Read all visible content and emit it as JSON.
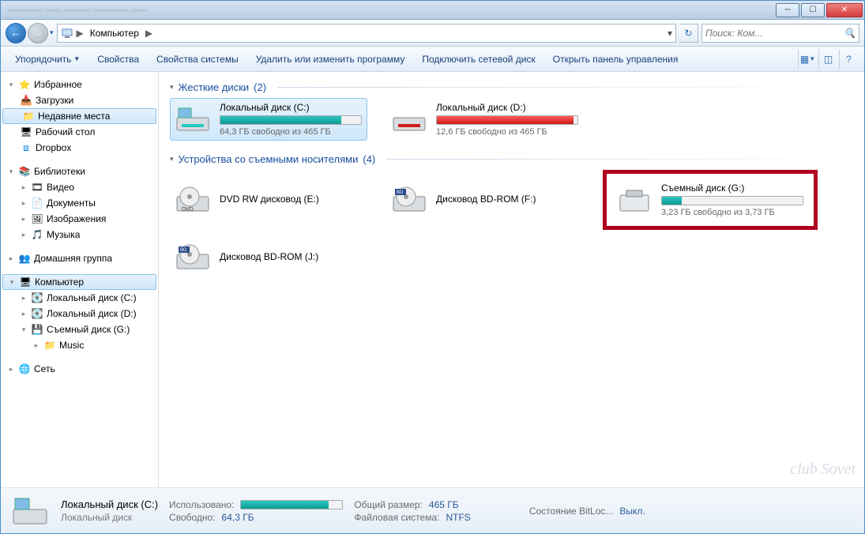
{
  "titlebar": {
    "blurred_text": "———— —— ——— ———— ——"
  },
  "address": {
    "location": "Компьютер",
    "chevron": "▶",
    "dropdown": "▾"
  },
  "search": {
    "placeholder": "Поиск: Ком..."
  },
  "toolbar": {
    "organize": "Упорядочить",
    "properties": "Свойства",
    "sysprops": "Свойства системы",
    "uninstall": "Удалить или изменить программу",
    "mapdrive": "Подключить сетевой диск",
    "controlpanel": "Открыть панель управления"
  },
  "sidebar": {
    "favorites": "Избранное",
    "downloads": "Загрузки",
    "recent": "Недавние места",
    "desktop": "Рабочий стол",
    "dropbox": "Dropbox",
    "libraries": "Библиотеки",
    "video": "Видео",
    "documents": "Документы",
    "pictures": "Изображения",
    "music": "Музыка",
    "homegroup": "Домашняя группа",
    "computer": "Компьютер",
    "localC": "Локальный диск (C:)",
    "localD": "Локальный диск (D:)",
    "removableG": "Съемный диск (G:)",
    "musicFolder": "Music",
    "network": "Сеть"
  },
  "groups": {
    "hdd": {
      "title": "Жесткие диски",
      "count": "(2)"
    },
    "removable": {
      "title": "Устройства со съемными носителями",
      "count": "(4)"
    }
  },
  "drives": {
    "c": {
      "name": "Локальный диск (C:)",
      "free": "64,3 ГБ свободно из 465 ГБ",
      "fill_pct": 86,
      "color_from": "#29c7c0",
      "color_to": "#0f9a94"
    },
    "d": {
      "name": "Локальный диск (D:)",
      "free": "12,6 ГБ свободно из 465 ГБ",
      "fill_pct": 97,
      "color_from": "#ff5a5a",
      "color_to": "#cc1a1a"
    },
    "dvd": {
      "name": "DVD RW дисковод (E:)"
    },
    "bdf": {
      "name": "Дисковод BD-ROM (F:)"
    },
    "bdj": {
      "name": "Дисковод BD-ROM (J:)"
    },
    "g": {
      "name": "Съемный диск (G:)",
      "free": "3,23 ГБ свободно из 3,73 ГБ",
      "fill_pct": 14,
      "color_from": "#29c7c0",
      "color_to": "#0f9a94"
    }
  },
  "details": {
    "title": "Локальный диск (C:)",
    "subtitle": "Локальный диск",
    "used_label": "Использовано:",
    "used_pct": 86,
    "free_label": "Свободно:",
    "free_val": "64,3 ГБ",
    "size_label": "Общий размер:",
    "size_val": "465 ГБ",
    "fs_label": "Файловая система:",
    "fs_val": "NTFS",
    "bitloc_label": "Состояние BitLoc...",
    "bitloc_val": "Выкл."
  },
  "watermark": "club Sovet"
}
